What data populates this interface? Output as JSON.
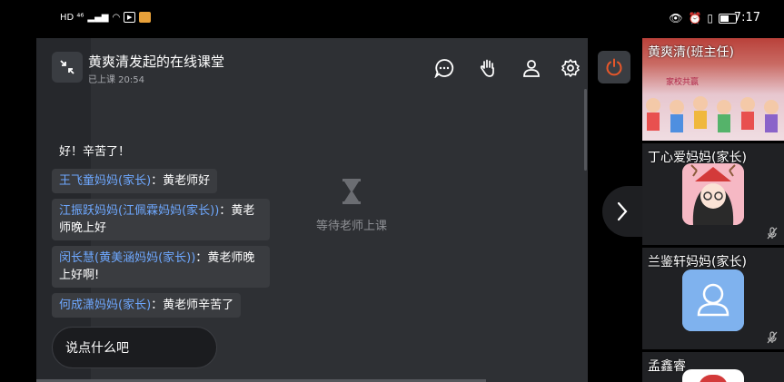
{
  "status_bar": {
    "signal_text": "HD ⁴⁶",
    "time": "7:17"
  },
  "classroom": {
    "title": "黄爽清发起的在线课堂",
    "status": "已上课  20:54",
    "waiting_text": "等待老师上课",
    "toolbar": [
      "chat-icon",
      "raise-hand-icon",
      "member-icon",
      "settings-icon"
    ],
    "leave_icon": "power-icon",
    "accent_color": "#e8572a"
  },
  "chat": {
    "partial_message": "好！辛苦了！",
    "messages": [
      {
        "sender": "王飞童妈妈(家长)",
        "text": "黄老师好"
      },
      {
        "sender": "江振跃妈妈(江佩霖妈妈(家长))",
        "text": "黄老师晚上好"
      },
      {
        "sender": "闵长慧(黄美涵妈妈(家长))",
        "text": "黄老师晚上好啊!"
      },
      {
        "sender": "何成潇妈妈(家长)",
        "text": "黄老师辛苦了"
      }
    ],
    "input_placeholder": "说点什么吧"
  },
  "participants": [
    {
      "name": "黄爽清(班主任)",
      "screen_text": "家校共赢"
    },
    {
      "name": "丁心爱妈妈(家长)"
    },
    {
      "name": "兰鉴轩妈妈(家长)"
    },
    {
      "name": "孟鑫睿"
    }
  ]
}
